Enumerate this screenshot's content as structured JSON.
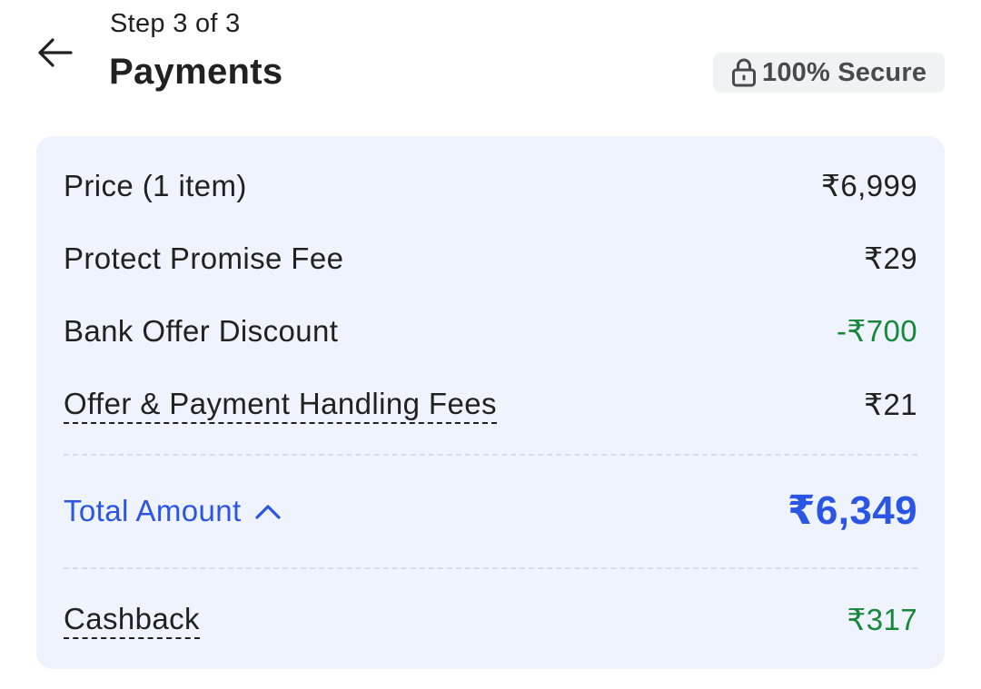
{
  "header": {
    "step": "Step 3 of 3",
    "title": "Payments",
    "secure_badge": "100% Secure",
    "back_icon": "arrow-left-icon",
    "lock_icon": "lock-icon"
  },
  "summary": {
    "rows": [
      {
        "label": "Price (1 item)",
        "value": "₹6,999"
      },
      {
        "label": "Protect Promise Fee",
        "value": "₹29"
      },
      {
        "label": "Bank Offer Discount",
        "value": "-₹700"
      },
      {
        "label": "Offer & Payment Handling Fees",
        "value": "₹21"
      }
    ],
    "total": {
      "label": "Total Amount",
      "value": "₹6,349",
      "icon": "chevron-up-icon"
    },
    "cashback": {
      "label": "Cashback",
      "value": "₹317"
    }
  },
  "colors": {
    "accent": "#2a55e5",
    "positive": "#17873a",
    "card_bg": "#eff3fd"
  }
}
